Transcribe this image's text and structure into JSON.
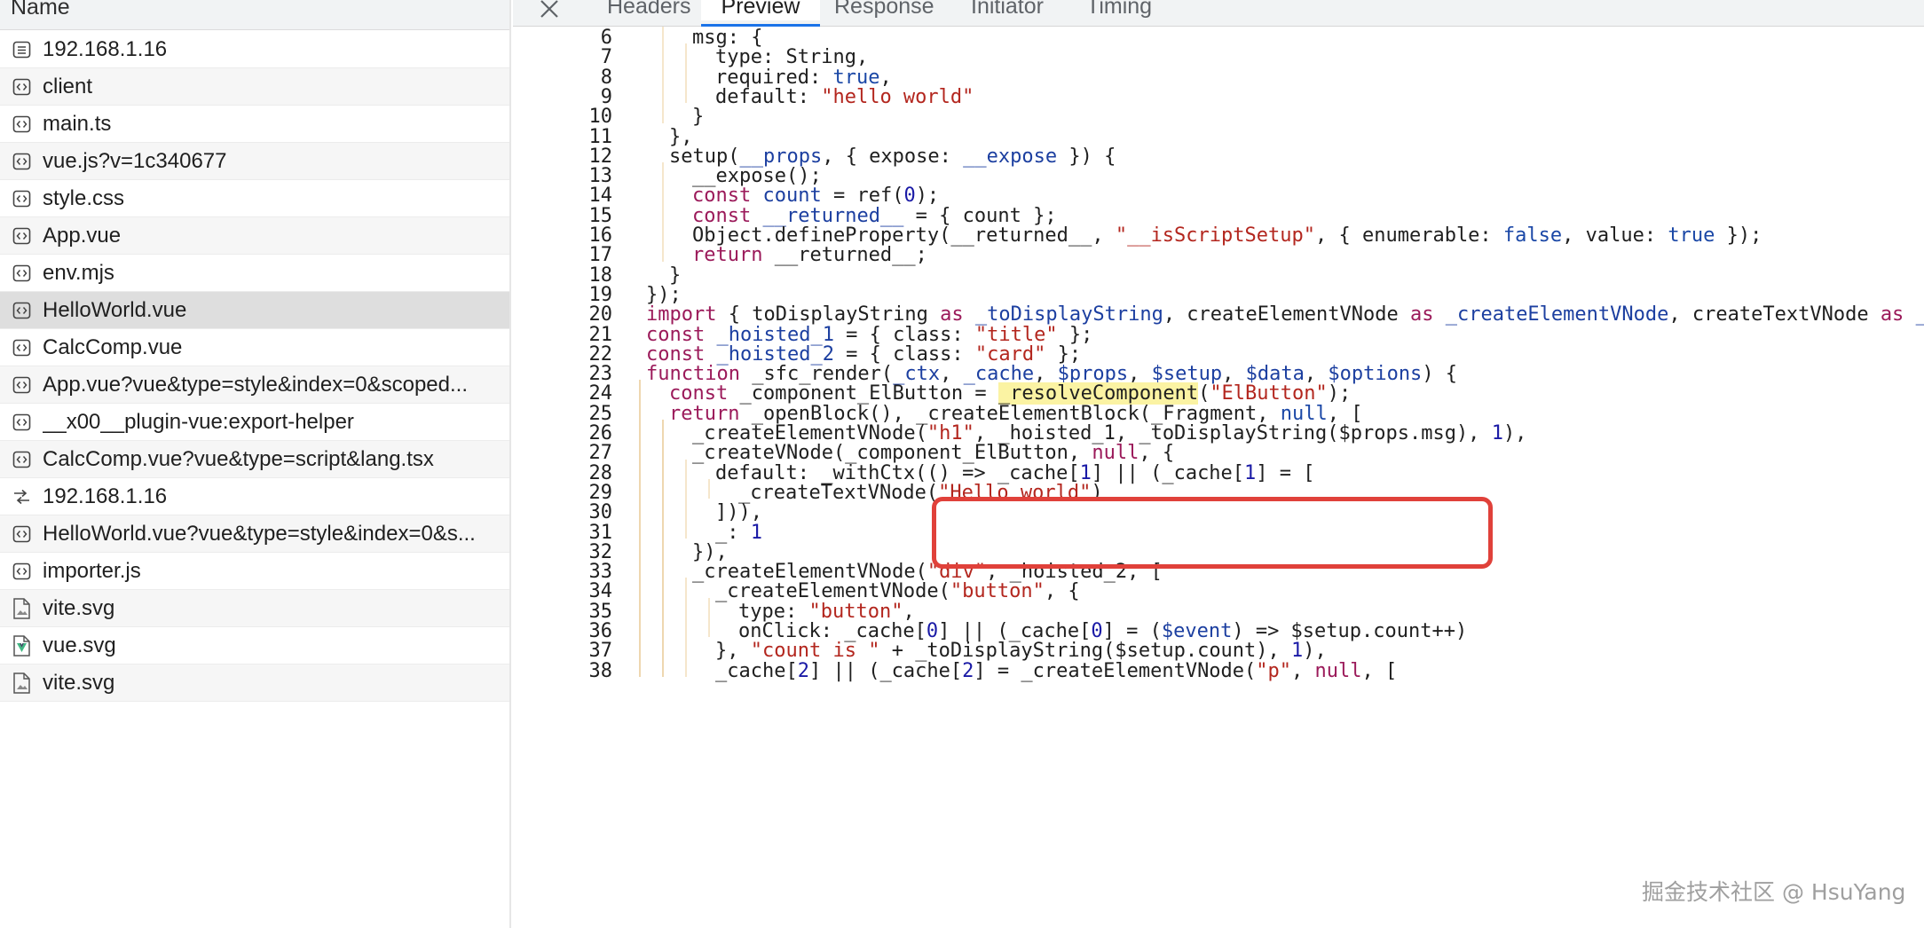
{
  "left_panel": {
    "header": "Name",
    "files": [
      {
        "name": "192.168.1.16",
        "icon": "document-icon"
      },
      {
        "name": "client",
        "icon": "script-icon"
      },
      {
        "name": "main.ts",
        "icon": "script-icon"
      },
      {
        "name": "vue.js?v=1c340677",
        "icon": "script-icon"
      },
      {
        "name": "style.css",
        "icon": "script-icon"
      },
      {
        "name": "App.vue",
        "icon": "script-icon"
      },
      {
        "name": "env.mjs",
        "icon": "script-icon"
      },
      {
        "name": "HelloWorld.vue",
        "icon": "script-icon",
        "selected": true
      },
      {
        "name": "CalcComp.vue",
        "icon": "script-icon"
      },
      {
        "name": "App.vue?vue&type=style&index=0&scoped...",
        "icon": "script-icon"
      },
      {
        "name": "__x00__plugin-vue:export-helper",
        "icon": "script-icon"
      },
      {
        "name": "CalcComp.vue?vue&type=script&lang.tsx",
        "icon": "script-icon"
      },
      {
        "name": "192.168.1.16",
        "icon": "websocket-icon"
      },
      {
        "name": "HelloWorld.vue?vue&type=style&index=0&s...",
        "icon": "script-icon"
      },
      {
        "name": "importer.js",
        "icon": "script-icon"
      },
      {
        "name": "vite.svg",
        "icon": "image-file-icon"
      },
      {
        "name": "vue.svg",
        "icon": "vue-image-icon"
      },
      {
        "name": "vite.svg",
        "icon": "image-file-icon"
      }
    ]
  },
  "tabs": {
    "close_icon": "close-icon",
    "items": [
      "Headers",
      "Preview",
      "Response",
      "Initiator",
      "Timing"
    ],
    "active": "Preview"
  },
  "code": {
    "lines": [
      {
        "n": "6",
        "indent": 2,
        "tokens": [
          [
            "p",
            "msg: {"
          ]
        ]
      },
      {
        "n": "7",
        "indent": 3,
        "tokens": [
          [
            "p",
            "type: String,"
          ]
        ]
      },
      {
        "n": "8",
        "indent": 3,
        "tokens": [
          [
            "p",
            "required: "
          ],
          [
            "bool",
            "true"
          ],
          [
            "p",
            ","
          ]
        ]
      },
      {
        "n": "9",
        "indent": 3,
        "tokens": [
          [
            "p",
            "default: "
          ],
          [
            "str",
            "\"hello world\""
          ]
        ]
      },
      {
        "n": "10",
        "indent": 2,
        "tokens": [
          [
            "p",
            "}"
          ]
        ]
      },
      {
        "n": "11",
        "indent": 1,
        "tokens": [
          [
            "p",
            "},"
          ]
        ]
      },
      {
        "n": "12",
        "indent": 1,
        "tokens": [
          [
            "p",
            "setup("
          ],
          [
            "id",
            "__props"
          ],
          [
            "p",
            ", { expose: "
          ],
          [
            "id",
            "__expose"
          ],
          [
            "p",
            " }) {"
          ]
        ]
      },
      {
        "n": "13",
        "indent": 2,
        "tokens": [
          [
            "p",
            "__expose();"
          ]
        ]
      },
      {
        "n": "14",
        "indent": 2,
        "tokens": [
          [
            "kw",
            "const "
          ],
          [
            "id",
            "count"
          ],
          [
            "p",
            " = ref("
          ],
          [
            "num",
            "0"
          ],
          [
            "p",
            ");"
          ]
        ]
      },
      {
        "n": "15",
        "indent": 2,
        "tokens": [
          [
            "kw",
            "const "
          ],
          [
            "id",
            "__returned__"
          ],
          [
            "p",
            " = { count };"
          ]
        ]
      },
      {
        "n": "16",
        "indent": 2,
        "tokens": [
          [
            "p",
            "Object.defineProperty(__returned__, "
          ],
          [
            "str",
            "\"__isScriptSetup\""
          ],
          [
            "p",
            ", { enumerable: "
          ],
          [
            "bool",
            "false"
          ],
          [
            "p",
            ", value: "
          ],
          [
            "bool",
            "true"
          ],
          [
            "p",
            " });"
          ]
        ]
      },
      {
        "n": "17",
        "indent": 2,
        "tokens": [
          [
            "kw",
            "return "
          ],
          [
            "p",
            "__returned__;"
          ]
        ]
      },
      {
        "n": "18",
        "indent": 1,
        "tokens": [
          [
            "p",
            "}"
          ]
        ]
      },
      {
        "n": "19",
        "indent": 0,
        "tokens": [
          [
            "p",
            "});"
          ]
        ]
      },
      {
        "n": "20",
        "indent": 0,
        "tokens": [
          [
            "kw",
            "import "
          ],
          [
            "p",
            "{ toDisplayString "
          ],
          [
            "kw",
            "as "
          ],
          [
            "id",
            "_toDisplayString"
          ],
          [
            "p",
            ", createElementVNode "
          ],
          [
            "kw",
            "as "
          ],
          [
            "id",
            "_createElementVNode"
          ],
          [
            "p",
            ", createTextVNode "
          ],
          [
            "kw",
            "as "
          ],
          [
            "id",
            "_createTextVNode"
          ]
        ]
      },
      {
        "n": "21",
        "indent": 0,
        "tokens": [
          [
            "kw",
            "const "
          ],
          [
            "id",
            "_hoisted_1"
          ],
          [
            "p",
            " = { class: "
          ],
          [
            "str",
            "\"title\""
          ],
          [
            "p",
            " };"
          ]
        ]
      },
      {
        "n": "22",
        "indent": 0,
        "tokens": [
          [
            "kw",
            "const "
          ],
          [
            "id",
            "_hoisted_2"
          ],
          [
            "p",
            " = { class: "
          ],
          [
            "str",
            "\"card\""
          ],
          [
            "p",
            " };"
          ]
        ]
      },
      {
        "n": "23",
        "indent": 0,
        "tokens": [
          [
            "kw",
            "function "
          ],
          [
            "p",
            "_sfc_render("
          ],
          [
            "id",
            "_ctx"
          ],
          [
            "p",
            ", "
          ],
          [
            "id",
            "_cache"
          ],
          [
            "p",
            ", "
          ],
          [
            "id",
            "$props"
          ],
          [
            "p",
            ", "
          ],
          [
            "id",
            "$setup"
          ],
          [
            "p",
            ", "
          ],
          [
            "id",
            "$data"
          ],
          [
            "p",
            ", "
          ],
          [
            "id",
            "$options"
          ],
          [
            "p",
            ") {"
          ]
        ]
      },
      {
        "n": "24",
        "indent": 1,
        "tokens": [
          [
            "kw",
            "const "
          ],
          [
            "p",
            "_component_ElButton = "
          ],
          [
            "hl",
            "_resolveComponent"
          ],
          [
            "p",
            "("
          ],
          [
            "str",
            "\"ElButton\""
          ],
          [
            "p",
            ");"
          ]
        ]
      },
      {
        "n": "25",
        "indent": 1,
        "tokens": [
          [
            "kw",
            "return "
          ],
          [
            "p",
            "_openBlock(), _createElementBlock(_Fragment, "
          ],
          [
            "bool",
            "null"
          ],
          [
            "p",
            ", ["
          ]
        ]
      },
      {
        "n": "26",
        "indent": 2,
        "tokens": [
          [
            "p",
            "_createElementVNode("
          ],
          [
            "str",
            "\"h1\""
          ],
          [
            "p",
            ", _hoisted_1, _toDisplayString($props.msg), "
          ],
          [
            "num",
            "1"
          ],
          [
            "p",
            "),"
          ]
        ]
      },
      {
        "n": "27",
        "indent": 2,
        "tokens": [
          [
            "p",
            "_createVNode(_component_ElButton, "
          ],
          [
            "kw",
            "null"
          ],
          [
            "p",
            ", {"
          ]
        ]
      },
      {
        "n": "28",
        "indent": 3,
        "tokens": [
          [
            "p",
            "default: _withCtx(() => _cache["
          ],
          [
            "num",
            "1"
          ],
          [
            "p",
            "] || (_cache["
          ],
          [
            "num",
            "1"
          ],
          [
            "p",
            "] = ["
          ]
        ]
      },
      {
        "n": "29",
        "indent": 4,
        "tokens": [
          [
            "p",
            "_createTextVNode("
          ],
          [
            "str",
            "\"Hello world\""
          ],
          [
            "p",
            ")"
          ]
        ]
      },
      {
        "n": "30",
        "indent": 3,
        "tokens": [
          [
            "p",
            "])),"
          ]
        ]
      },
      {
        "n": "31",
        "indent": 3,
        "tokens": [
          [
            "p",
            "_: "
          ],
          [
            "num",
            "1"
          ]
        ]
      },
      {
        "n": "32",
        "indent": 2,
        "tokens": [
          [
            "p",
            "}),"
          ]
        ]
      },
      {
        "n": "33",
        "indent": 2,
        "tokens": [
          [
            "p",
            "_createElementVNode("
          ],
          [
            "str",
            "\"div\""
          ],
          [
            "p",
            ", _hoisted_2, ["
          ]
        ]
      },
      {
        "n": "34",
        "indent": 3,
        "tokens": [
          [
            "p",
            "_createElementVNode("
          ],
          [
            "str",
            "\"button\""
          ],
          [
            "p",
            ", {"
          ]
        ]
      },
      {
        "n": "35",
        "indent": 4,
        "tokens": [
          [
            "p",
            "type: "
          ],
          [
            "str",
            "\"button\""
          ],
          [
            "p",
            ","
          ]
        ]
      },
      {
        "n": "36",
        "indent": 4,
        "tokens": [
          [
            "p",
            "onClick: _cache["
          ],
          [
            "num",
            "0"
          ],
          [
            "p",
            "] || (_cache["
          ],
          [
            "num",
            "0"
          ],
          [
            "p",
            "] = ("
          ],
          [
            "id",
            "$event"
          ],
          [
            "p",
            ") => $setup.count++)"
          ]
        ]
      },
      {
        "n": "37",
        "indent": 3,
        "tokens": [
          [
            "p",
            "}, "
          ],
          [
            "str",
            "\"count is \""
          ],
          [
            "p",
            " + _toDisplayString($setup.count), "
          ],
          [
            "num",
            "1"
          ],
          [
            "p",
            "),"
          ]
        ]
      },
      {
        "n": "38",
        "indent": 3,
        "tokens": [
          [
            "p",
            "_cache["
          ],
          [
            "num",
            "2"
          ],
          [
            "p",
            "] || (_cache["
          ],
          [
            "num",
            "2"
          ],
          [
            "p",
            "] = _createElementVNode("
          ],
          [
            "str",
            "\"p\""
          ],
          [
            "p",
            ", "
          ],
          [
            "kw",
            "null"
          ],
          [
            "p",
            ", ["
          ]
        ]
      }
    ]
  },
  "watermark": "掘金技术社区 @ HsuYang",
  "colors": {
    "keyword": "#9b1a5a",
    "string": "#b3261e",
    "number": "#1a1aa6",
    "identifier": "#1c3fa0",
    "highlight": "#fbf3a3",
    "annotation_box": "#e0413a",
    "tab_accent": "#1a73e8"
  }
}
